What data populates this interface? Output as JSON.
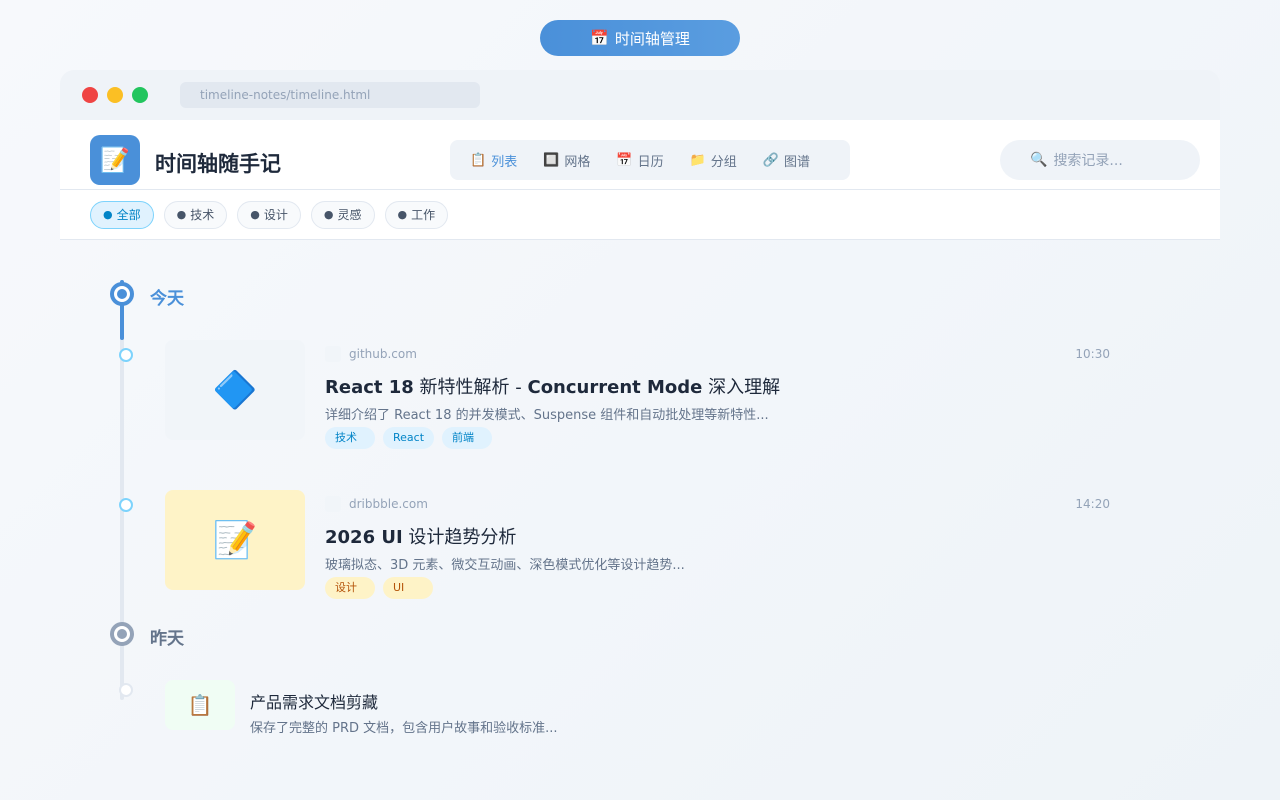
{
  "top_pill": {
    "icon": "📅",
    "label": "时间轴管理"
  },
  "browser": {
    "url": "timeline-notes/timeline.html"
  },
  "header": {
    "logo_icon": "📝",
    "title": "时间轴随手记",
    "view_tabs": [
      {
        "icon": "📋",
        "label": "列表",
        "active": true
      },
      {
        "icon": "🔲",
        "label": "网格",
        "active": false
      },
      {
        "icon": "📅",
        "label": "日历",
        "active": false
      },
      {
        "icon": "📁",
        "label": "分组",
        "active": false
      },
      {
        "icon": "🔗",
        "label": "图谱",
        "active": false
      }
    ],
    "search": {
      "icon": "🔍",
      "placeholder": "搜索记录..."
    }
  },
  "filters": [
    {
      "bullet": "●",
      "label": "全部",
      "active": true
    },
    {
      "bullet": "●",
      "label": "技术",
      "active": false
    },
    {
      "bullet": "●",
      "label": "设计",
      "active": false
    },
    {
      "bullet": "●",
      "label": "灵感",
      "active": false
    },
    {
      "bullet": "●",
      "label": "工作",
      "active": false
    }
  ],
  "timeline": {
    "today_label": "今天",
    "yesterday_label": "昨天",
    "entries": [
      {
        "thumb_icon": "🔷",
        "domain": "github.com",
        "time": "10:30",
        "title_bold_1": "React 18",
        "title_mid": " 新特性解析 - ",
        "title_bold_2": "Concurrent Mode",
        "title_end": " 深入理解",
        "desc": "详细介绍了 React 18 的并发模式、Suspense 组件和自动批处理等新特性...",
        "tags": [
          "技术",
          "React",
          "前端"
        ]
      },
      {
        "thumb_icon": "📝",
        "domain": "dribbble.com",
        "time": "14:20",
        "title_bold_1": "2026 UI",
        "title_mid": " 设计趋势分析",
        "desc": "玻璃拟态、3D 元素、微交互动画、深色模式优化等设计趋势...",
        "tags": [
          "设计",
          "UI"
        ]
      },
      {
        "thumb_icon": "📋",
        "title": "产品需求文档剪藏",
        "desc": "保存了完整的 PRD 文档，包含用户故事和验收标准..."
      }
    ]
  },
  "colors": {
    "accent": "#4a90d9",
    "tag_blue": "#e0f2fe",
    "tag_yellow": "#fef3c7"
  }
}
